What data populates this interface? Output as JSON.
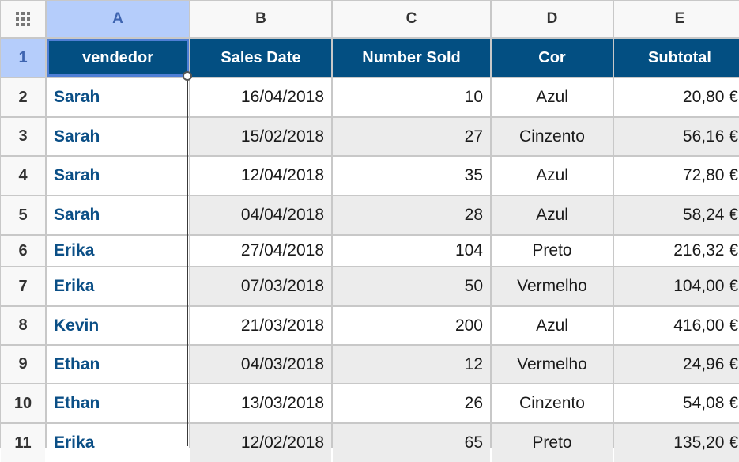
{
  "column_headers": [
    "A",
    "B",
    "C",
    "D",
    "E"
  ],
  "selected_column": "A",
  "selected_row": "1",
  "corner_icon": "select-all-grid-icon",
  "row_numbers": [
    "1",
    "2",
    "3",
    "4",
    "5",
    "6",
    "7",
    "8",
    "9",
    "10",
    "11"
  ],
  "table": {
    "headers": [
      "vendedor",
      "Sales Date",
      "Number Sold",
      "Cor",
      "Subtotal"
    ],
    "rows": [
      [
        "Sarah",
        "16/04/2018",
        "10",
        "Azul",
        "20,80 €"
      ],
      [
        "Sarah",
        "15/02/2018",
        "27",
        "Cinzento",
        "56,16 €"
      ],
      [
        "Sarah",
        "12/04/2018",
        "35",
        "Azul",
        "72,80 €"
      ],
      [
        "Sarah",
        "04/04/2018",
        "28",
        "Azul",
        "58,24 €"
      ],
      [
        "Erika",
        "27/04/2018",
        "104",
        "Preto",
        "216,32 €"
      ],
      [
        "Erika",
        "07/03/2018",
        "50",
        "Vermelho",
        "104,00 €"
      ],
      [
        "Kevin",
        "21/03/2018",
        "200",
        "Azul",
        "416,00 €"
      ],
      [
        "Ethan",
        "04/03/2018",
        "12",
        "Vermelho",
        "24,96 €"
      ],
      [
        "Ethan",
        "13/03/2018",
        "26",
        "Cinzento",
        "54,08 €"
      ],
      [
        "Erika",
        "12/02/2018",
        "65",
        "Preto",
        "135,20 €"
      ]
    ]
  },
  "colors": {
    "header_fill": "#034f82",
    "header_text": "#ffffff",
    "name_text": "#0b4f86",
    "selection_highlight": "#b5cdfb",
    "alt_row_fill": "#ececec"
  }
}
